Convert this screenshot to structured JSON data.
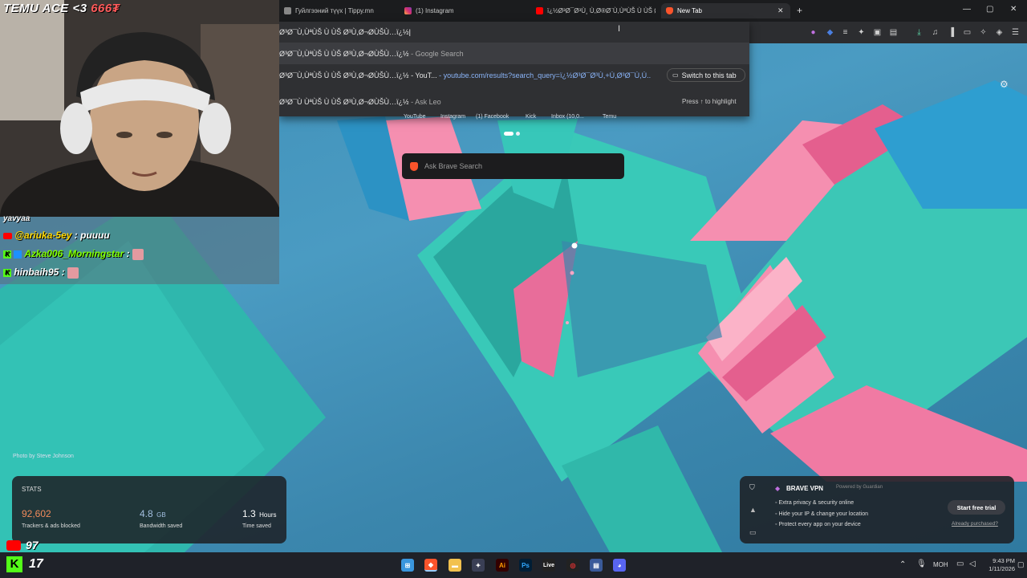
{
  "tabs": [
    {
      "title": "Гуйлгээний түүх | Tippy.mn",
      "color": "#888888"
    },
    {
      "title": "(1) Instagram",
      "color": "#d6306f"
    },
    {
      "title": "ï¿½Ø³Ø¯Ø³Ù¸ Ù,Ø®Ø¨Ù,ÙªÙŠ Ù ÙŠ Ø",
      "color": "#ff0000"
    },
    {
      "title": "New Tab",
      "color": "#fb542b"
    }
  ],
  "omnibox": {
    "input": "Ø³Ø¯Ù,ÙªÙŠ Ù ÙŠ Ø³Ù,Ø¬ØÙŠÙ…ï¿½",
    "rows": [
      {
        "text": "Ø³Ø¯Ù,ÙªÙŠ Ù ÙŠ Ø³Ù,Ø¬ØÙŠÙ…ï¿½",
        "suffix": "- Google Search"
      },
      {
        "text": "Ø³Ø¯Ù,ÙªÙŠ Ù ÙŠ Ø³Ù,Ø¬ØÙŠÙ…ï¿½ - YouT...",
        "url": "- youtube.com/results?search_query=ï¿½Ø³Ø¯Ø³Ù,+Ù,Ø³Ø¯Ù,Ù..",
        "button": "Switch to this tab"
      },
      {
        "text": "Ø³Ø¯Ù ÙªÙŠ Ù ÙŠ Ø³Ù,Ø¬ØÙŠÙ…ï¿½",
        "suffix": "- Ask Leo",
        "hint": "Press ↑ to highlight"
      }
    ]
  },
  "shortcuts": [
    "YouTube",
    "Instagram",
    "(1) Facebook",
    "Kick",
    "Inbox (10,0...",
    "Temu"
  ],
  "search": {
    "placeholder": "Ask Brave Search"
  },
  "photo_credit": "Photo by Steve Johnson",
  "stats": {
    "title": "STATS",
    "items": [
      {
        "value": "92,602",
        "unit": "",
        "label": "Trackers & ads blocked",
        "color": "#f28b5b"
      },
      {
        "value": "4.8",
        "unit": "GB",
        "label": "Bandwidth saved",
        "color": "#a3bfe0"
      },
      {
        "value": "1.3",
        "unit": "Hours",
        "label": "Time saved",
        "color": "#ffffff"
      }
    ]
  },
  "vpn": {
    "title": "BRAVE VPN",
    "powered": "Powered by",
    "provider": "Guardian",
    "features": [
      "Extra privacy & security online",
      "Hide your IP & change your location",
      "Protect every app on your device"
    ],
    "cta": "Start free trial",
    "link": "Already purchased?"
  },
  "stream": {
    "overlay_title": "TEMU ACE <3",
    "overlay_amount": "666₮",
    "chat_top": "yavyaa",
    "chat": [
      {
        "user": "@ariuka-5ey",
        "sep": ":",
        "msg": "puuuu",
        "platform": "youtube",
        "color": "#ffd700"
      },
      {
        "user": "Azka006_Morningstar",
        "sep": ":",
        "msg": "",
        "platform": "kick",
        "color": "#7fff00"
      },
      {
        "user": "hinbaih95",
        "sep": ":",
        "msg": "",
        "platform": "kick",
        "color": "#ffffff"
      }
    ],
    "youtube_count": "97",
    "kick_count": "17"
  },
  "taskbar": {
    "lang": "МОН",
    "time": "9:43 PM",
    "date": "1/11/2026"
  },
  "colors": {
    "accent": "#fb542b",
    "teal": "#37c7b9",
    "pink": "#f06a98",
    "blue_bg": "#3d8db7"
  }
}
